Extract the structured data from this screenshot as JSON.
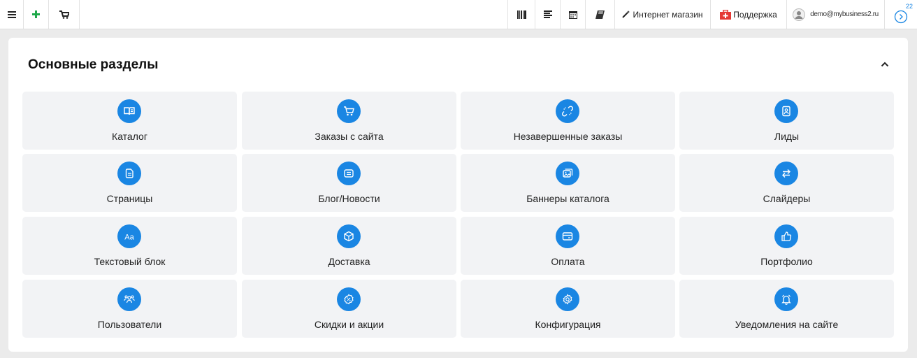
{
  "colors": {
    "accent": "#1a86e3",
    "support_red": "#e53935",
    "add_green": "#1ea84a",
    "tile_bg": "#f2f3f5",
    "page_bg": "#ebebeb"
  },
  "topbar": {
    "icons_left": [
      "menu-icon",
      "plus-icon",
      "cart-icon"
    ],
    "icons_right": [
      "barcode-icon",
      "list-icon",
      "calendar-icon",
      "book-icon"
    ],
    "shop_label": "Интернет магазин",
    "support_label": "Поддержка",
    "user_email": "demo@mybusiness2.ru",
    "notifications_count": "22"
  },
  "section": {
    "title": "Основные разделы",
    "collapse_icon": "chevron-up-icon",
    "tiles": [
      {
        "label": "Каталог",
        "icon": "book-open-icon"
      },
      {
        "label": "Заказы с сайта",
        "icon": "cart-icon"
      },
      {
        "label": "Незавершенные заказы",
        "icon": "broken-link-icon"
      },
      {
        "label": "Лиды",
        "icon": "contact-card-icon"
      },
      {
        "label": "Страницы",
        "icon": "pages-icon"
      },
      {
        "label": "Блог/Новости",
        "icon": "news-icon"
      },
      {
        "label": "Баннеры каталога",
        "icon": "gallery-icon"
      },
      {
        "label": "Слайдеры",
        "icon": "arrows-swap-icon"
      },
      {
        "label": "Текстовый блок",
        "icon": "text-font-icon"
      },
      {
        "label": "Доставка",
        "icon": "box-icon"
      },
      {
        "label": "Оплата",
        "icon": "card-icon"
      },
      {
        "label": "Портфолио",
        "icon": "thumbs-up-icon"
      },
      {
        "label": "Пользователи",
        "icon": "users-icon"
      },
      {
        "label": "Скидки и акции",
        "icon": "discount-icon"
      },
      {
        "label": "Конфигурация",
        "icon": "settings-icon"
      },
      {
        "label": "Уведомления на сайте",
        "icon": "bell-icon"
      }
    ]
  }
}
